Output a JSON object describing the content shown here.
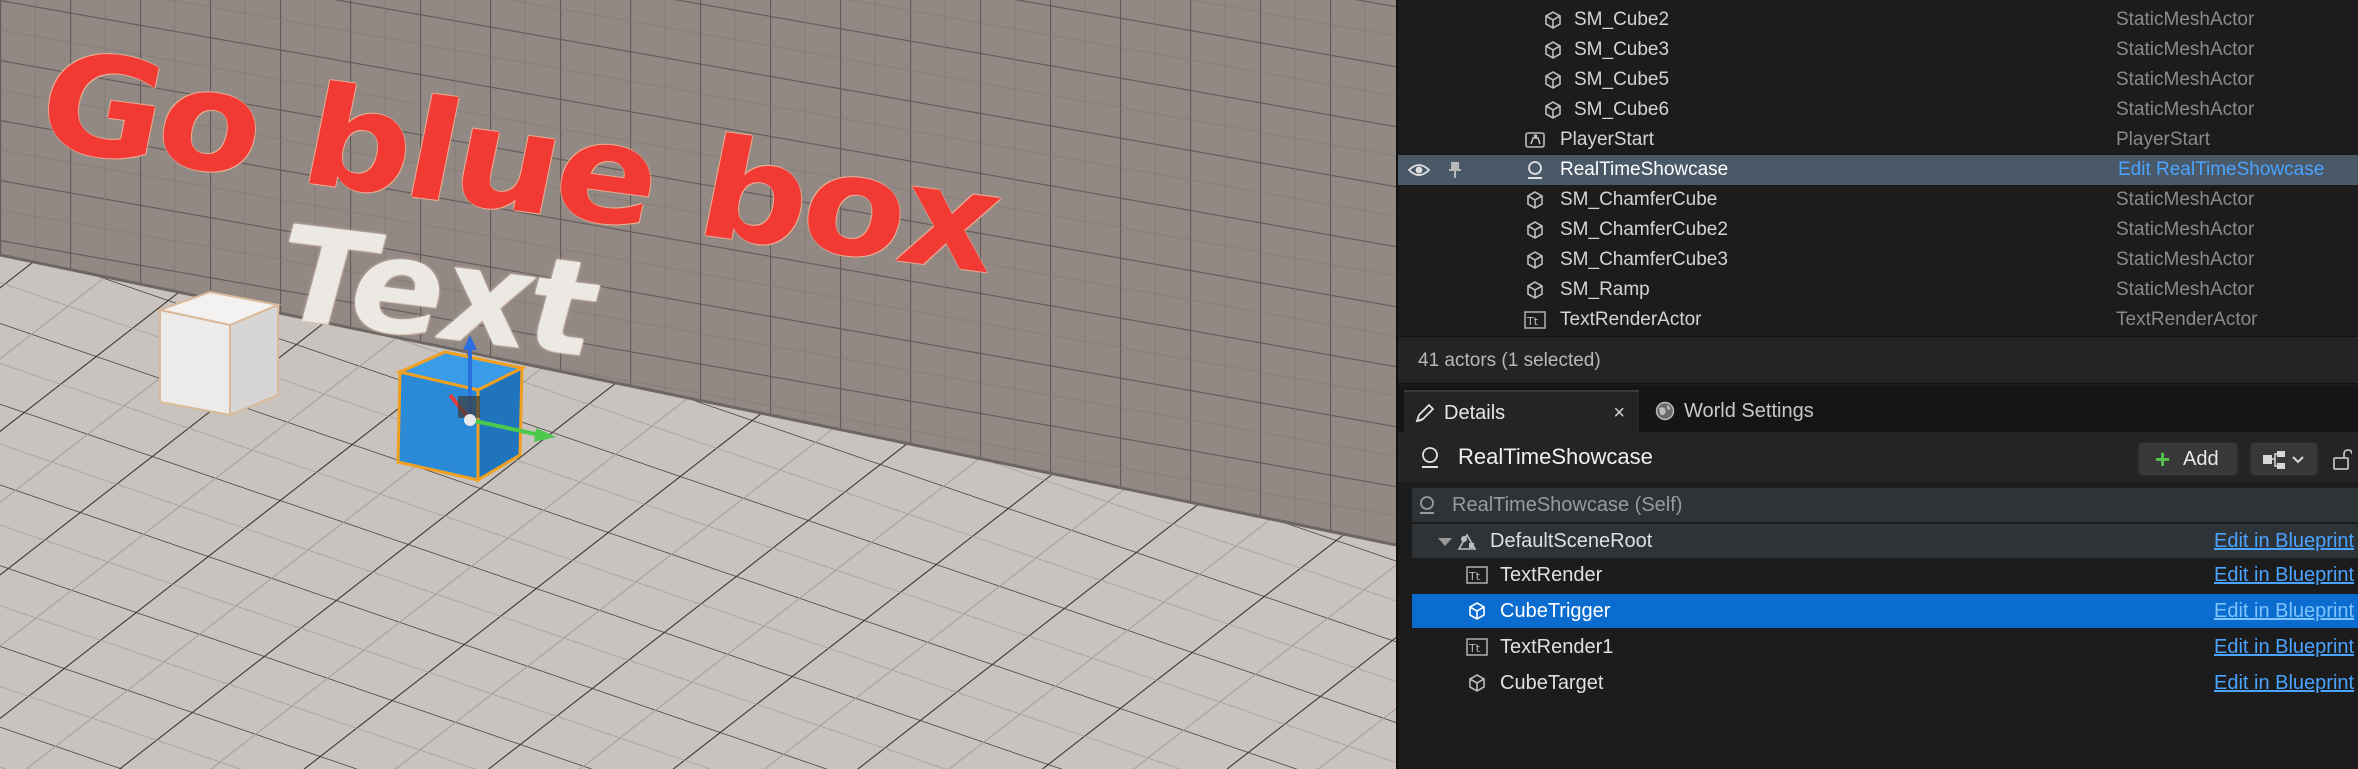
{
  "viewport": {
    "red_text": "Go blue box",
    "white_text": "Text"
  },
  "outliner": {
    "rows": [
      {
        "name": "SM_Cube2",
        "type": "StaticMeshActor",
        "icon": "static-mesh-icon"
      },
      {
        "name": "SM_Cube3",
        "type": "StaticMeshActor",
        "icon": "static-mesh-icon"
      },
      {
        "name": "SM_Cube5",
        "type": "StaticMeshActor",
        "icon": "static-mesh-icon"
      },
      {
        "name": "SM_Cube6",
        "type": "StaticMeshActor",
        "icon": "static-mesh-icon"
      },
      {
        "name": "PlayerStart",
        "type": "PlayerStart",
        "icon": "player-start-icon"
      },
      {
        "name": "RealTimeShowcase",
        "type": "Edit RealTimeShowcase",
        "icon": "actor-sphere-icon",
        "selected": true
      },
      {
        "name": "SM_ChamferCube",
        "type": "StaticMeshActor",
        "icon": "static-mesh-icon"
      },
      {
        "name": "SM_ChamferCube2",
        "type": "StaticMeshActor",
        "icon": "static-mesh-icon"
      },
      {
        "name": "SM_ChamferCube3",
        "type": "StaticMeshActor",
        "icon": "static-mesh-icon"
      },
      {
        "name": "SM_Ramp",
        "type": "StaticMeshActor",
        "icon": "static-mesh-icon"
      },
      {
        "name": "TextRenderActor",
        "type": "TextRenderActor",
        "icon": "text-render-icon"
      }
    ],
    "footer": "41 actors (1 selected)"
  },
  "tabs": {
    "details": "Details",
    "close": "×",
    "world_settings": "World Settings"
  },
  "details": {
    "actor_name": "RealTimeShowcase",
    "add_label": "Add",
    "components": [
      {
        "name": "RealTimeShowcase (Self)",
        "edit": "",
        "icon": "actor-sphere-icon"
      },
      {
        "name": "DefaultSceneRoot",
        "edit": "Edit in Blueprint",
        "icon": "scene-root-icon"
      },
      {
        "name": "TextRender",
        "edit": "Edit in Blueprint",
        "icon": "text-render-icon"
      },
      {
        "name": "CubeTrigger",
        "edit": "Edit in Blueprint",
        "icon": "static-mesh-icon",
        "selected": true
      },
      {
        "name": "TextRender1",
        "edit": "Edit in Blueprint",
        "icon": "text-render-icon"
      },
      {
        "name": "CubeTarget",
        "edit": "Edit in Blueprint",
        "icon": "static-mesh-icon"
      }
    ]
  },
  "colors": {
    "selection_row": "#4a5968",
    "selected_component": "#0a6ccf",
    "link": "#4aa3ff",
    "red_text": "#f23a35",
    "blue_cube": "#2a8ad8"
  }
}
